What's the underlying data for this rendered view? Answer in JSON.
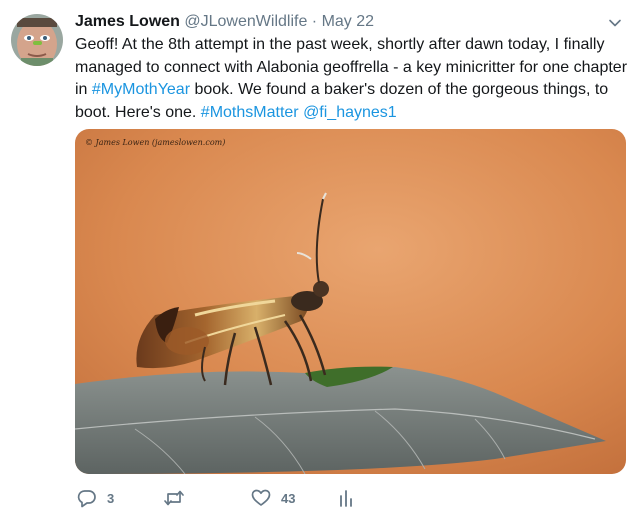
{
  "tweet": {
    "author_name": "James Lowen",
    "handle": "@JLowenWildlife",
    "separator": "·",
    "date": "May 22",
    "text_parts": [
      {
        "text": "Geoff! At the 8th attempt in the past week, shortly after dawn today, I finally managed to connect with Alabonia geoffrella - a key minicritter for one chapter in ",
        "kind": "plain"
      },
      {
        "text": "#MyMothYear",
        "kind": "link"
      },
      {
        "text": " book. We found a baker's dozen of the gorgeous things, to boot. Here's one. ",
        "kind": "plain"
      },
      {
        "text": "#MothsMatter",
        "kind": "link"
      },
      {
        "text": " ",
        "kind": "plain"
      },
      {
        "text": "@fi_haynes1",
        "kind": "link"
      }
    ],
    "media_watermark": "© James Lowen (jameslowen.com)"
  },
  "actions": {
    "reply_count": "3",
    "retweet_count": "",
    "like_count": "43"
  },
  "icons": {
    "reply": "reply-icon",
    "retweet": "retweet-icon",
    "like": "heart-icon",
    "analytics": "analytics-icon",
    "more": "chevron-down-icon"
  },
  "colors": {
    "link": "#1b95e0",
    "muted": "#657786",
    "background_photo": "#d9884f"
  }
}
